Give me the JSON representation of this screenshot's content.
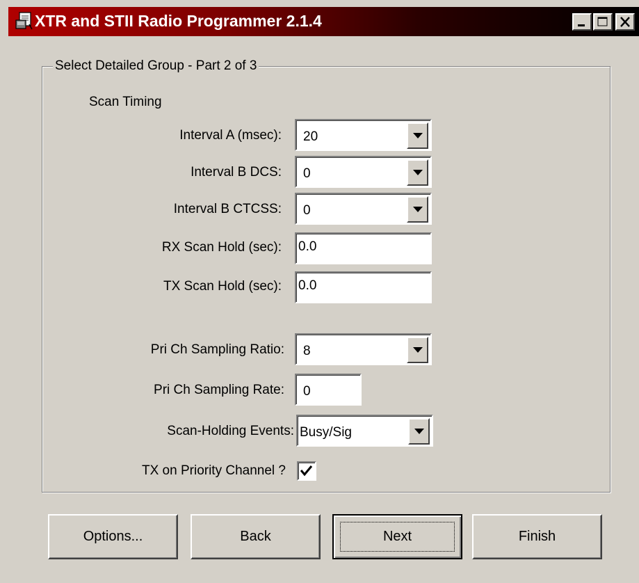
{
  "window": {
    "title": "XTR and STII Radio Programmer 2.1.4",
    "titlebar_colors": [
      "#b00000",
      "#000000"
    ]
  },
  "group": {
    "legend": "Select Detailed Group - Part 2 of 3",
    "section_title": "Scan Timing"
  },
  "fields": {
    "interval_a": {
      "label": "Interval A (msec):",
      "value": "20"
    },
    "interval_b_dcs": {
      "label": "Interval B DCS:",
      "value": "0"
    },
    "interval_b_ctcss": {
      "label": "Interval B CTCSS:",
      "value": "0"
    },
    "rx_scan_hold": {
      "label": "RX Scan Hold (sec):",
      "value": "0.0"
    },
    "tx_scan_hold": {
      "label": "TX Scan Hold (sec):",
      "value": "0.0"
    },
    "pri_sampling_ratio": {
      "label": "Pri Ch Sampling Ratio:",
      "value": "8"
    },
    "pri_sampling_rate": {
      "label": "Pri Ch Sampling Rate:",
      "value": "0"
    },
    "scan_holding_events": {
      "label": "Scan-Holding Events:",
      "value": "Busy/Sig"
    },
    "tx_priority": {
      "label": "TX on Priority Channel ?",
      "checked": true
    }
  },
  "buttons": {
    "options": "Options...",
    "back": "Back",
    "next": "Next",
    "finish": "Finish"
  },
  "icons": {
    "app": "app-icon",
    "minimize": "minimize-icon",
    "maximize": "maximize-icon",
    "close": "close-icon",
    "dropdown": "chevron-down-icon",
    "check": "checkmark-icon"
  }
}
